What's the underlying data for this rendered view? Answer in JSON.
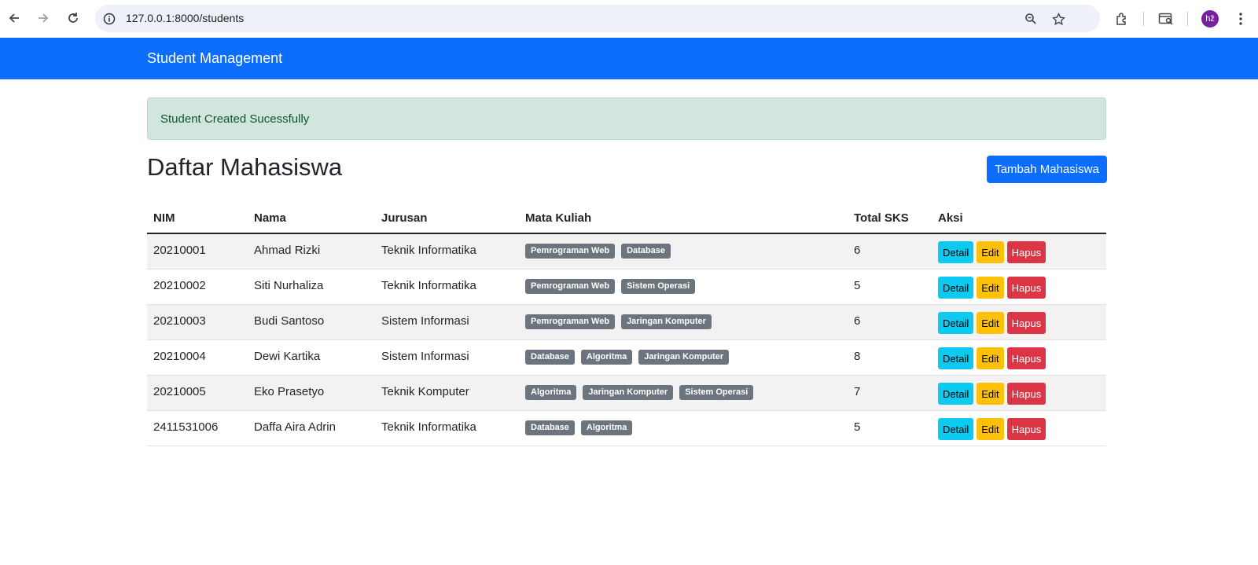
{
  "browser": {
    "url": "127.0.0.1:8000/students",
    "avatar_initials": "hž",
    "icons": [
      "back-arrow-icon",
      "forward-arrow-icon",
      "reload-icon",
      "site-info-icon",
      "zoom-icon",
      "bookmark-star-icon",
      "extensions-icon",
      "tab-search-icon",
      "kebab-menu-icon"
    ]
  },
  "navbar": {
    "brand": "Student Management",
    "color": "#0d6efd"
  },
  "alert": {
    "message": "Student Created Sucessfully"
  },
  "page": {
    "title": "Daftar Mahasiswa",
    "add_button": "Tambah Mahasiswa"
  },
  "table": {
    "headers": {
      "nim": "NIM",
      "nama": "Nama",
      "jurusan": "Jurusan",
      "mata_kuliah": "Mata Kuliah",
      "total_sks": "Total SKS",
      "aksi": "Aksi"
    },
    "actions": {
      "detail": "Detail",
      "edit": "Edit",
      "hapus": "Hapus"
    },
    "rows": [
      {
        "nim": "20210001",
        "nama": "Ahmad Rizki",
        "jurusan": "Teknik Informatika",
        "mata_kuliah": [
          "Pemrograman Web",
          "Database"
        ],
        "total_sks": "6"
      },
      {
        "nim": "20210002",
        "nama": "Siti Nurhaliza",
        "jurusan": "Teknik Informatika",
        "mata_kuliah": [
          "Pemrograman Web",
          "Sistem Operasi"
        ],
        "total_sks": "5"
      },
      {
        "nim": "20210003",
        "nama": "Budi Santoso",
        "jurusan": "Sistem Informasi",
        "mata_kuliah": [
          "Pemrograman Web",
          "Jaringan Komputer"
        ],
        "total_sks": "6"
      },
      {
        "nim": "20210004",
        "nama": "Dewi Kartika",
        "jurusan": "Sistem Informasi",
        "mata_kuliah": [
          "Database",
          "Algoritma",
          "Jaringan Komputer"
        ],
        "total_sks": "8"
      },
      {
        "nim": "20210005",
        "nama": "Eko Prasetyo",
        "jurusan": "Teknik Komputer",
        "mata_kuliah": [
          "Algoritma",
          "Jaringan Komputer",
          "Sistem Operasi"
        ],
        "total_sks": "7"
      },
      {
        "nim": "2411531006",
        "nama": "Daffa Aira Adrin",
        "jurusan": "Teknik Informatika",
        "mata_kuliah": [
          "Database",
          "Algoritma"
        ],
        "total_sks": "5"
      }
    ]
  }
}
